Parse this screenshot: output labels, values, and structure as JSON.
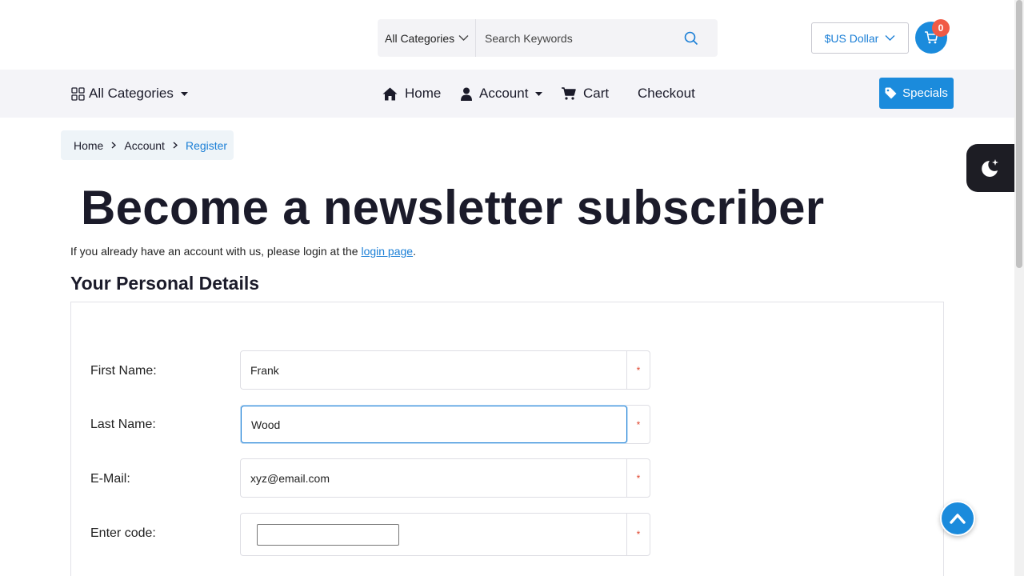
{
  "header": {
    "search_category": "All Categories",
    "search_placeholder": "Search Keywords",
    "currency": "$US Dollar",
    "cart_count": "0"
  },
  "nav": {
    "all_categories": "All Categories",
    "items": [
      {
        "label": "Home",
        "icon": "home-icon"
      },
      {
        "label": "Account",
        "icon": "user-icon"
      },
      {
        "label": "Cart",
        "icon": "cart-icon"
      },
      {
        "label": "Checkout"
      }
    ],
    "specials": "Specials"
  },
  "breadcrumb": [
    "Home",
    "Account",
    "Register"
  ],
  "page": {
    "title": "Become a newsletter subscriber",
    "intro_before": "If you already have an account with us, please login at the ",
    "intro_link": "login page",
    "intro_after": ".",
    "section_title": "Your Personal Details"
  },
  "form": {
    "first_name_label": "First Name:",
    "first_name_value": "Frank",
    "last_name_label": "Last Name:",
    "last_name_value": "Wood",
    "email_label": "E-Mail:",
    "email_value": "xyz@email.com",
    "code_label": "Enter code:",
    "required_mark": "*"
  },
  "colors": {
    "accent": "#1b8bdc",
    "link": "#1b7fd6",
    "badge": "#f05a46",
    "required": "#e0452e"
  }
}
